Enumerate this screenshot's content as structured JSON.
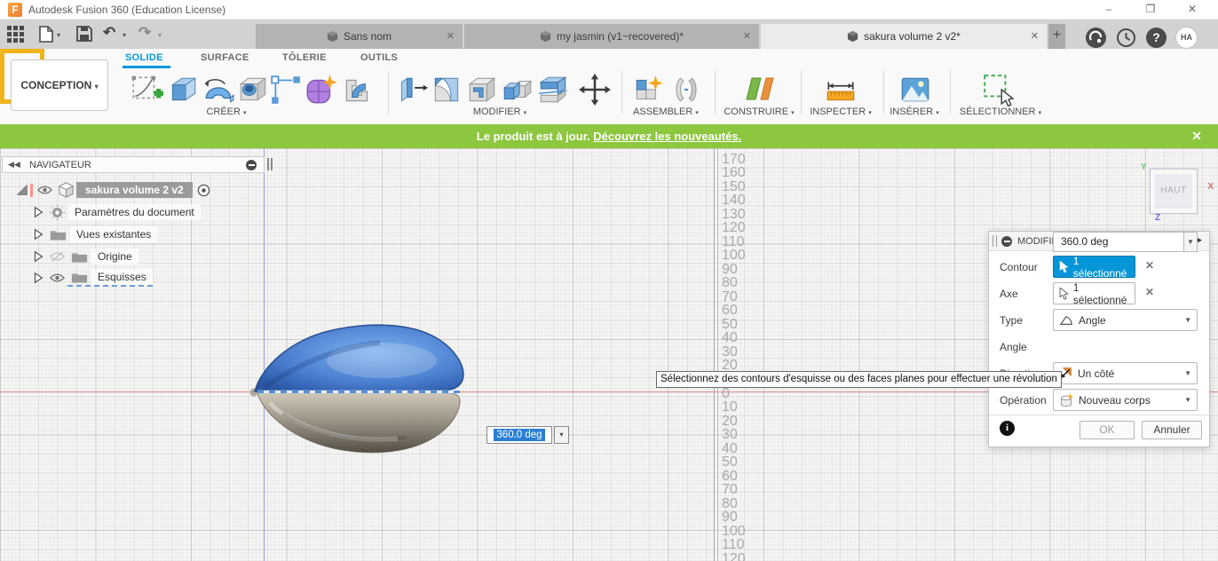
{
  "titlebar": {
    "title": "Autodesk Fusion 360 (Education License)"
  },
  "document_tabs": [
    {
      "label": "Sans nom"
    },
    {
      "label": "my jasmin (v1~recovered)*"
    },
    {
      "label": "sakura volume 2 v2*"
    }
  ],
  "user_avatar": "HA",
  "ribbon": {
    "workspace_label": "CONCEPTION",
    "tabs": [
      {
        "label": "SOLIDE",
        "active": true
      },
      {
        "label": "SURFACE",
        "active": false
      },
      {
        "label": "TÔLERIE",
        "active": false
      },
      {
        "label": "OUTILS",
        "active": false
      }
    ],
    "groups": [
      {
        "label": "CRÉER"
      },
      {
        "label": "MODIFIER"
      },
      {
        "label": "ASSEMBLER"
      },
      {
        "label": "CONSTRUIRE"
      },
      {
        "label": "INSPECTER"
      },
      {
        "label": "INSÉRER"
      },
      {
        "label": "SÉLECTIONNER"
      }
    ]
  },
  "notification": {
    "message": "Le produit est à jour.",
    "link_label": "Découvrez les nouveautés."
  },
  "navigator": {
    "title": "NAVIGATEUR",
    "root_label": "sakura volume 2 v2",
    "items": [
      {
        "label": "Paramètres du document"
      },
      {
        "label": "Vues existantes"
      },
      {
        "label": "Origine"
      },
      {
        "label": "Esquisses"
      }
    ]
  },
  "viewport": {
    "viewcube_face": "HAUT",
    "axes": {
      "x": "X",
      "y": "Y",
      "z": "Z"
    },
    "ruler_labels": [
      "170",
      "160",
      "150",
      "140",
      "130",
      "120",
      "110",
      "100",
      "90",
      "80",
      "70",
      "60",
      "50",
      "40",
      "30",
      "20",
      "10",
      "0",
      "10",
      "20",
      "30",
      "40",
      "50",
      "60",
      "70",
      "80",
      "90",
      "100",
      "110",
      "120"
    ],
    "angle_value": "360.0 deg"
  },
  "dialog": {
    "title": "MODIFIER LA FONCTION",
    "rows": [
      {
        "label": "Contour",
        "value": "1 sélectionné"
      },
      {
        "label": "Axe",
        "value": "1 sélectionné"
      },
      {
        "label": "Type",
        "value": "Angle"
      },
      {
        "label": "Angle",
        "value": "360.0 deg"
      },
      {
        "label": "Direction",
        "value": "Un côté"
      },
      {
        "label": "Opération",
        "value": "Nouveau corps"
      }
    ],
    "ok_label": "OK",
    "cancel_label": "Annuler"
  },
  "tooltip": "Sélectionnez des contours d'esquisse ou des faces planes pour effectuer une révolution",
  "colors": {
    "accent_blue": "#0696d7",
    "highlight_yellow": "#f0b41c",
    "notification_green": "#8dc63f"
  }
}
